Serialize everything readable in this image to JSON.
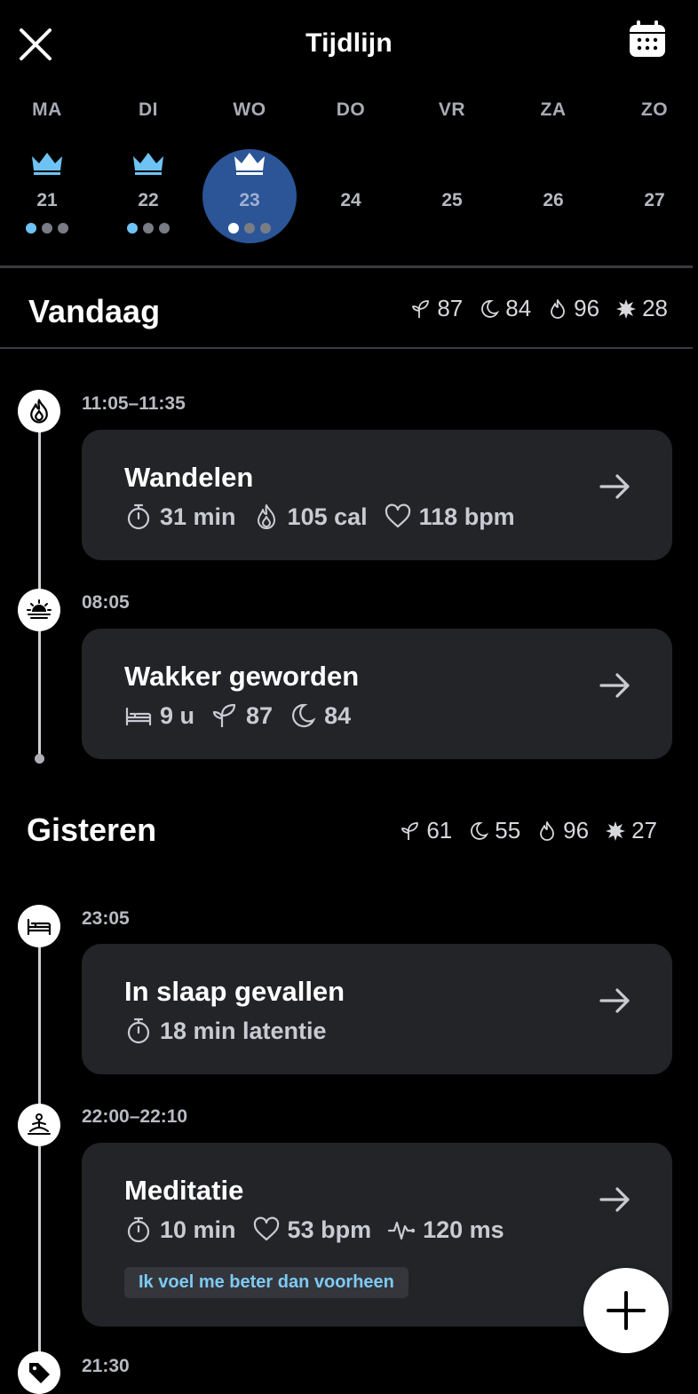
{
  "header": {
    "title": "Tijdlijn"
  },
  "week": [
    {
      "name": "MA",
      "num": "21",
      "crown": true,
      "dots": [
        "blue",
        "grey",
        "grey"
      ],
      "selected": false
    },
    {
      "name": "DI",
      "num": "22",
      "crown": true,
      "dots": [
        "blue",
        "grey",
        "grey"
      ],
      "selected": false
    },
    {
      "name": "WO",
      "num": "23",
      "crown": true,
      "dots": [
        "white",
        "grey",
        "grey"
      ],
      "selected": true
    },
    {
      "name": "DO",
      "num": "24",
      "crown": false,
      "dots": [],
      "selected": false
    },
    {
      "name": "VR",
      "num": "25",
      "crown": false,
      "dots": [],
      "selected": false
    },
    {
      "name": "ZA",
      "num": "26",
      "crown": false,
      "dots": [],
      "selected": false
    },
    {
      "name": "ZO",
      "num": "27",
      "crown": false,
      "dots": [],
      "selected": false
    }
  ],
  "today": {
    "title": "Vandaag",
    "stats": {
      "recovery": "87",
      "sleep": "84",
      "activity": "96",
      "strain": "28"
    }
  },
  "yesterday": {
    "title": "Gisteren",
    "stats": {
      "recovery": "61",
      "sleep": "55",
      "activity": "96",
      "strain": "27"
    }
  },
  "events": {
    "walk": {
      "time": "11:05–11:35",
      "title": "Wandelen",
      "duration": "31 min",
      "calories": "105 cal",
      "heart": "118 bpm"
    },
    "wake": {
      "time": "08:05",
      "title": "Wakker geworden",
      "sleep": "9 u",
      "recovery": "87",
      "sleep_score": "84"
    },
    "asleep": {
      "time": "23:05",
      "title": "In slaap gevallen",
      "latency": "18 min latentie"
    },
    "meditation": {
      "time": "22:00–22:10",
      "title": "Meditatie",
      "duration": "10 min",
      "heart": "53 bpm",
      "hrv": "120 ms",
      "tag": "Ik voel me beter dan voorheen"
    },
    "tag_event": {
      "time": "21:30"
    }
  },
  "colors": {
    "accent_blue": "#6ec3f4",
    "selected_day": "#2b5597",
    "card_bg": "#232428"
  }
}
